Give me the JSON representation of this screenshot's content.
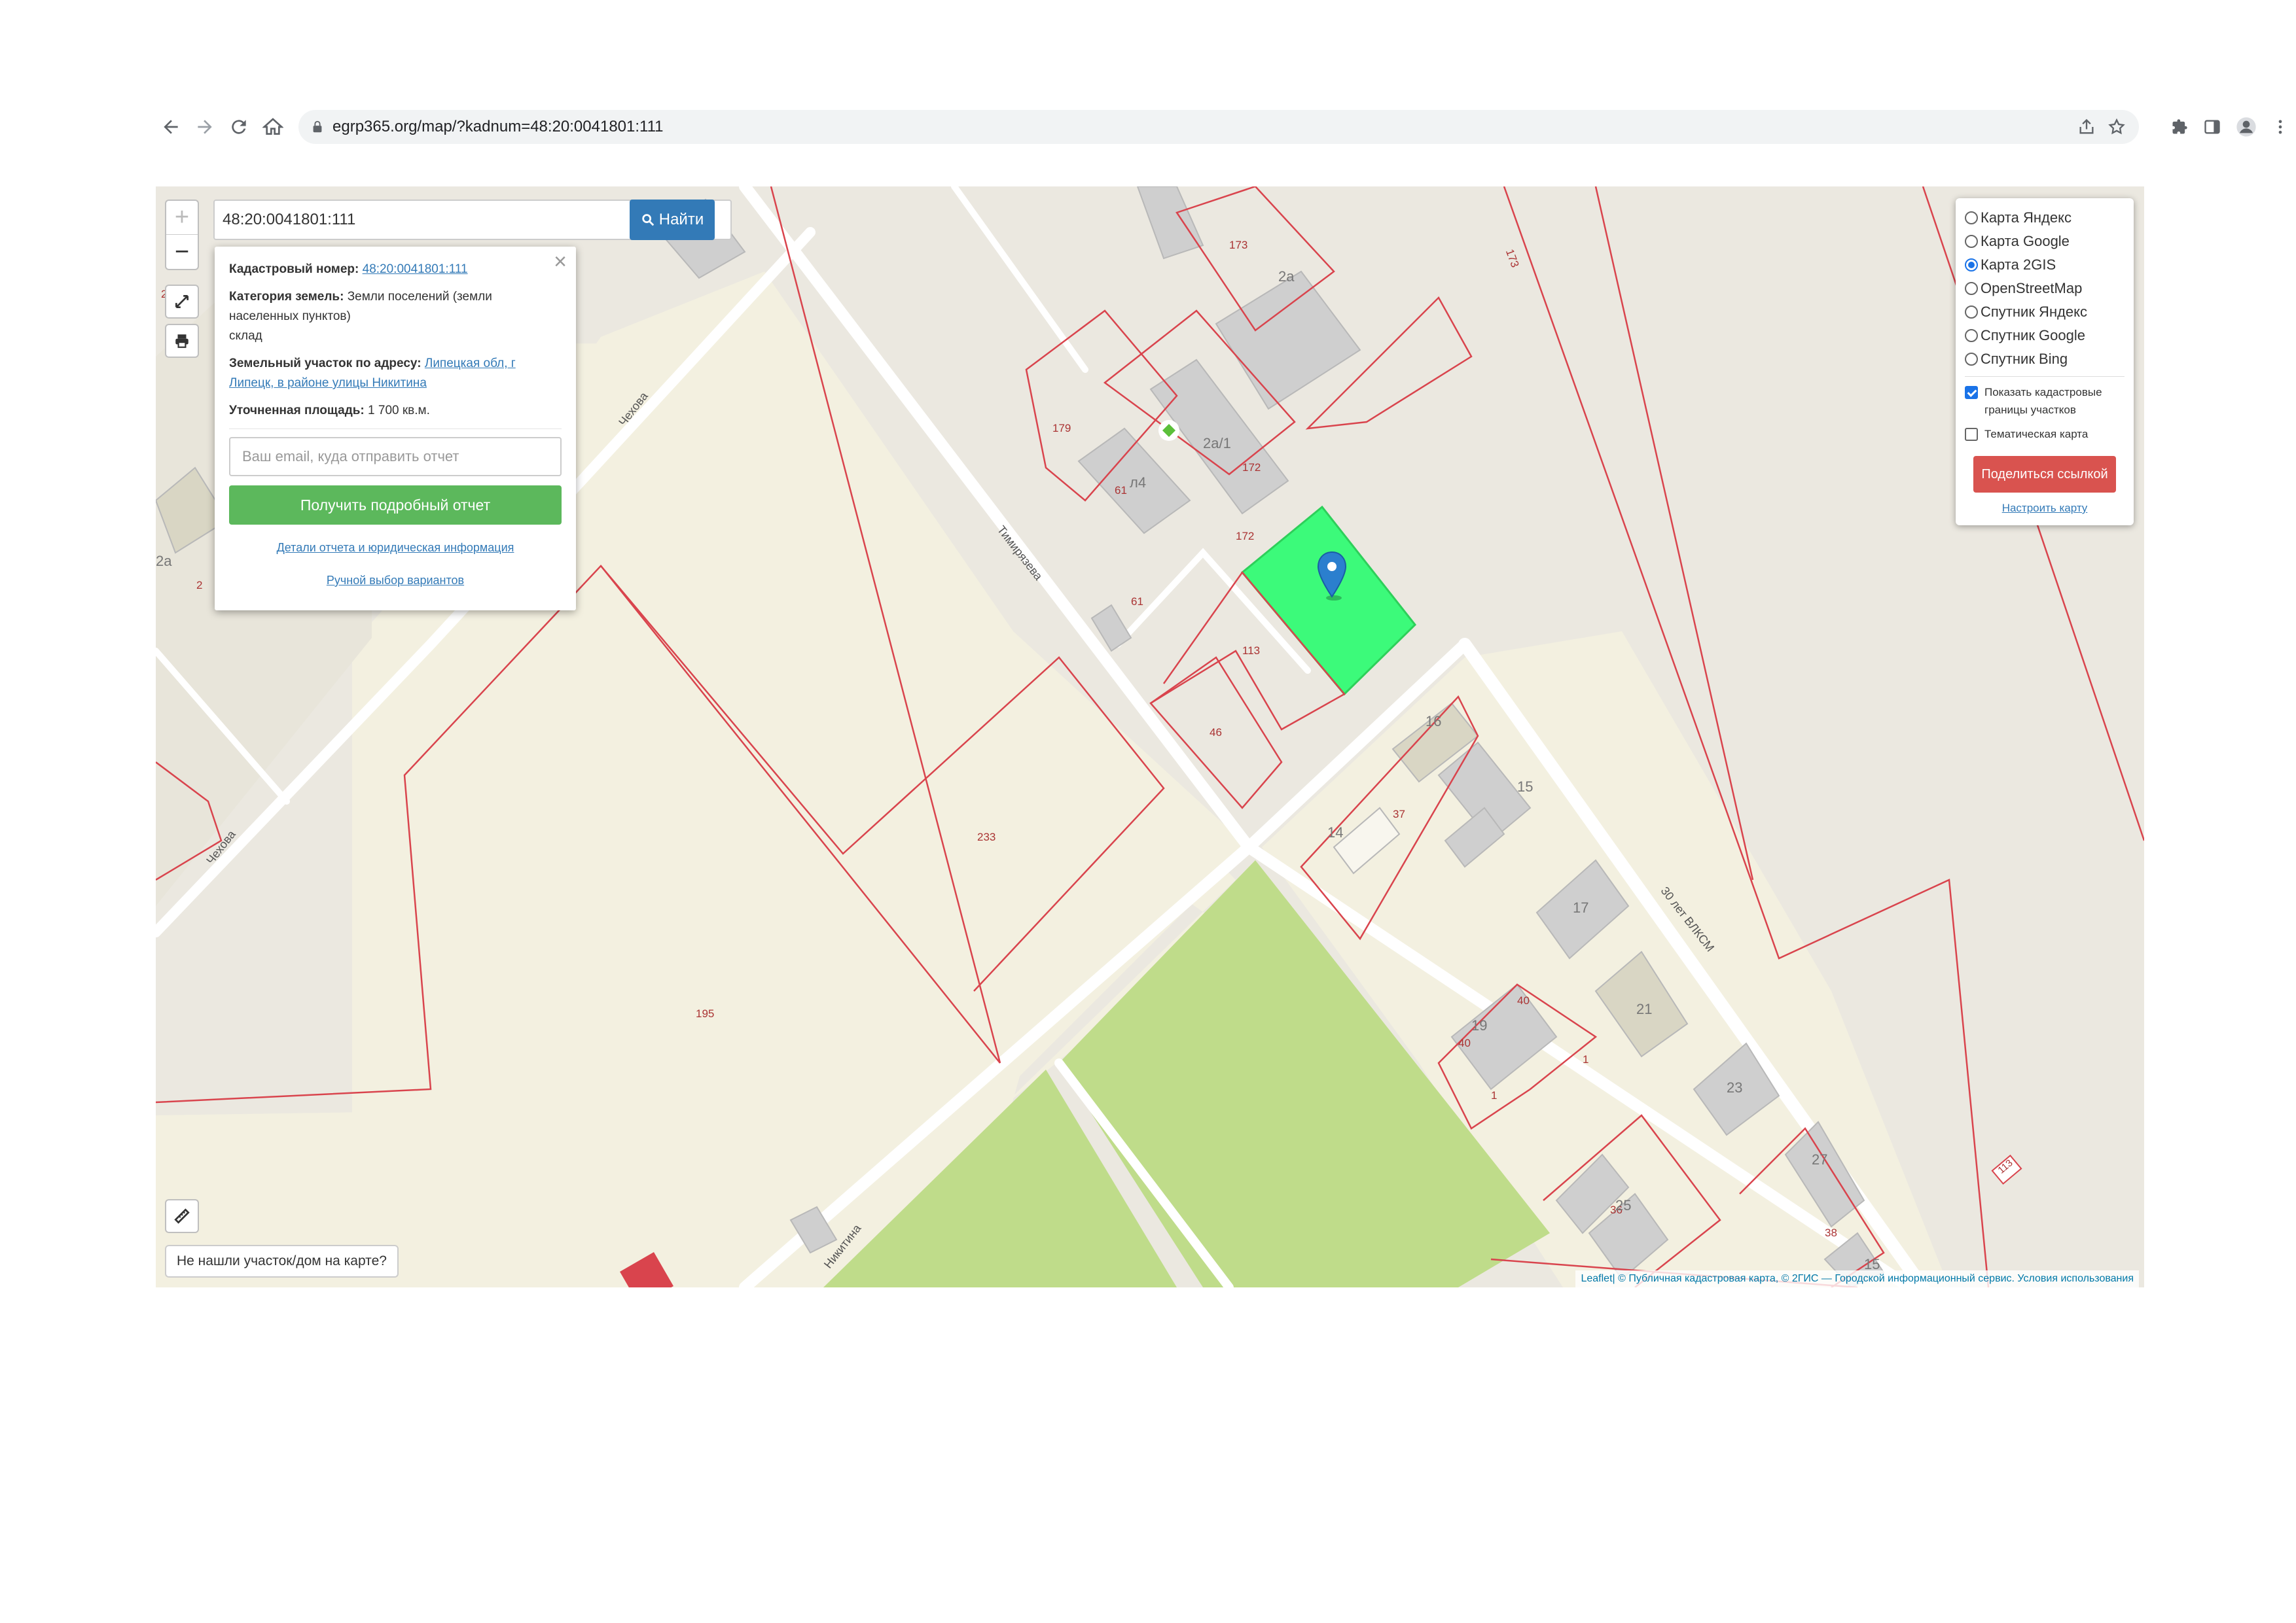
{
  "browser": {
    "url": "egrp365.org/map/?kadnum=48:20:0041801:111"
  },
  "search": {
    "value": "48:20:0041801:111",
    "button_label": "Найти"
  },
  "zoom": {
    "in_label": "+",
    "out_label": "−"
  },
  "popup": {
    "cadastral_label": "Кадастровый номер:",
    "cadastral_value": "48:20:0041801:111",
    "category_label": "Категория земель:",
    "category_value": "Земли поселений (земли населенных пунктов)",
    "use_value": "склад",
    "address_label": "Земельный участок по адресу:",
    "address_value": "Липецкая обл, г Липецк, в районе улицы Никитина",
    "area_label": "Уточненная площадь:",
    "area_value": "1 700 кв.м.",
    "email_placeholder": "Ваш email, куда отправить отчет",
    "report_button": "Получить подробный отчет",
    "details_link": "Детали отчета и юридическая информация",
    "manual_link": "Ручной выбор вариантов"
  },
  "layers": {
    "options": [
      {
        "label": "Карта Яндекс",
        "selected": false
      },
      {
        "label": "Карта Google",
        "selected": false
      },
      {
        "label": "Карта 2GIS",
        "selected": true
      },
      {
        "label": "OpenStreetMap",
        "selected": false
      },
      {
        "label": "Спутник Яндекс",
        "selected": false
      },
      {
        "label": "Спутник Google",
        "selected": false
      },
      {
        "label": "Спутник Bing",
        "selected": false
      }
    ],
    "show_borders_label": "Показать кадастровые границы участков",
    "show_borders_checked": true,
    "thematic_label": "Тематическая карта",
    "thematic_checked": false,
    "share_button": "Поделиться ссылкой",
    "setup_link": "Настроить карту"
  },
  "map": {
    "not_found_label": "Не нашли участок/дом на карте?",
    "attribution_leaflet": "Leaflet",
    "attribution_rest": " | © Публичная кадастровая карта, © 2ГИС — Городской информационный сервис. Условия использования",
    "streets": {
      "chekhova_1": "Чехова",
      "chekhova_2": "Чехова",
      "timiryazeva": "Тимирязева",
      "nikitina": "Никитина",
      "vlksm": "30 лет ВЛКСМ"
    },
    "parcel_numbers": {
      "p173": "173",
      "p179": "179",
      "p172a": "172",
      "p172b": "172",
      "p61a": "61",
      "p61b": "61",
      "p113": "113",
      "p46": "46",
      "p233": "233",
      "p195": "195",
      "p37": "37",
      "p40a": "40",
      "p40b": "40",
      "p1a": "1",
      "p1b": "1",
      "p36": "36",
      "p38": "38",
      "p2": "2",
      "p2b": "2",
      "p173r": "173",
      "p113r": "113"
    },
    "house_numbers": {
      "h2a": "2а",
      "h2a1": "2а/1",
      "h4": "л4",
      "h16": "16",
      "h15": "15",
      "h14": "14",
      "h17": "17",
      "h21": "21",
      "h19": "19",
      "h23": "23",
      "h27": "27",
      "h25": "25",
      "h15b": "15",
      "h2a_left": "2а"
    },
    "colors": {
      "background": "#ebe8e0",
      "residential": "#f3f0e0",
      "park": "#bfdc8a",
      "selected_parcel": "#3cfa7a",
      "parcel_border": "#d9444d",
      "building": "#cfcfcf",
      "road": "#ffffff"
    }
  }
}
